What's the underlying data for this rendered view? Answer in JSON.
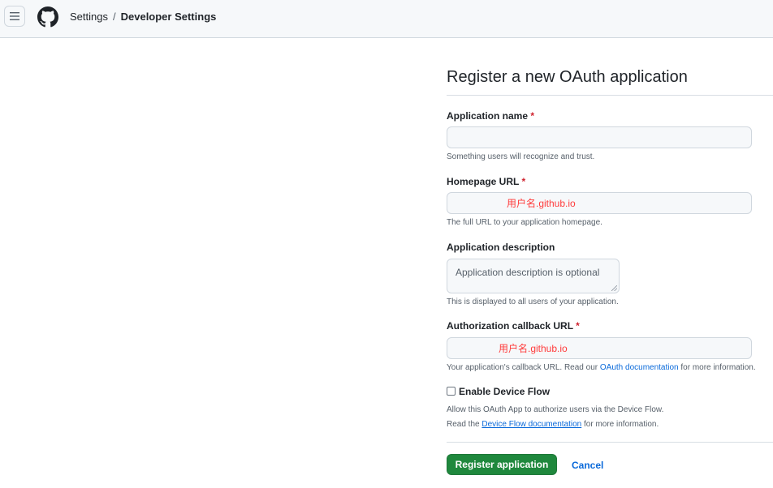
{
  "header": {
    "breadcrumb_root": "Settings",
    "breadcrumb_sep": "/",
    "breadcrumb_current": "Developer Settings"
  },
  "page": {
    "title": "Register a new OAuth application"
  },
  "form": {
    "app_name": {
      "label": "Application name",
      "required_mark": "*",
      "value": "",
      "hint": "Something users will recognize and trust."
    },
    "homepage_url": {
      "label": "Homepage URL",
      "required_mark": "*",
      "value": "用户名.github.io",
      "hint": "The full URL to your application homepage."
    },
    "description": {
      "label": "Application description",
      "placeholder": "Application description is optional",
      "hint": "This is displayed to all users of your application."
    },
    "callback_url": {
      "label": "Authorization callback URL",
      "required_mark": "*",
      "value": "用户名.github.io",
      "hint_before": "Your application's callback URL. Read our ",
      "hint_link": "OAuth documentation",
      "hint_after": " for more information."
    },
    "device_flow": {
      "label": "Enable Device Flow",
      "checked": false,
      "hint_line1": "Allow this OAuth App to authorize users via the Device Flow.",
      "hint_line2_before": "Read the ",
      "hint_line2_link": "Device Flow documentation",
      "hint_line2_after": " for more information."
    }
  },
  "actions": {
    "register_label": "Register application",
    "cancel_label": "Cancel"
  },
  "colors": {
    "primary_button": "#1f883d",
    "link": "#0969da",
    "required": "#cf222e",
    "entered_value": "#ff3b3b"
  }
}
